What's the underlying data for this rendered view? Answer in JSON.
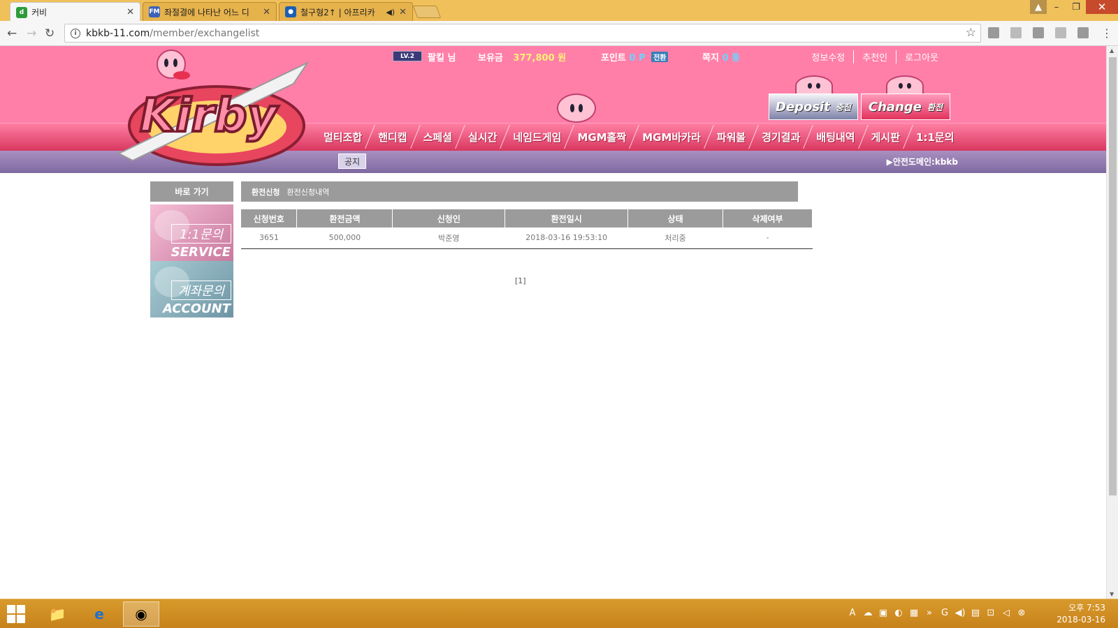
{
  "browser": {
    "tabs": [
      {
        "title": "커비",
        "favicon": "d",
        "active": true
      },
      {
        "title": "좌절결에 나타난 어느 디",
        "favicon": "FM",
        "active": false
      },
      {
        "title": "철구형2↑ | 아프리카",
        "favicon": "afreeca",
        "active": false
      }
    ],
    "url_host": "kbkb-11.com",
    "url_path": "/member/exchangelist"
  },
  "header": {
    "level_badge": "LV.2",
    "username": "팔킬 님",
    "balance_label": "보유금",
    "balance_value": "377,800 원",
    "points_label": "포인트",
    "points_value": "0 P",
    "convert_label": "전환",
    "messages_label": "쪽지",
    "messages_value": "0 통",
    "links": [
      "정보수정",
      "추천인",
      "로그아웃"
    ],
    "deposit_en": "Deposit",
    "deposit_ko": "충전",
    "change_en": "Change",
    "change_ko": "환전",
    "logo_text": "Kirby"
  },
  "nav": {
    "items": [
      "멀티조합",
      "핸디캡",
      "스페셜",
      "실시간",
      "네임드게임",
      "MGM홀짝",
      "MGM바카라",
      "파워볼",
      "경기결과",
      "배팅내역",
      "게시판",
      "1:1문의"
    ]
  },
  "notice": {
    "button": "공지",
    "safe_domain": "▶안전도메인:kbkb"
  },
  "sidebar": {
    "title": "바로 가기",
    "banners": [
      {
        "ko": "1:1문의",
        "en": "SERVICE"
      },
      {
        "ko": "계좌문의",
        "en": "ACCOUNT"
      }
    ]
  },
  "content": {
    "breadcrumb": [
      "환전신청",
      "환전신청내역"
    ],
    "columns": [
      "신청번호",
      "환전금액",
      "신청인",
      "환전일시",
      "상태",
      "삭제여부"
    ],
    "rows": [
      [
        "3651",
        "500,000",
        "박준영",
        "2018-03-16 19:53:10",
        "처리중",
        "-"
      ]
    ],
    "pager": "[1]"
  },
  "taskbar": {
    "clock_time": "오후 7:53",
    "clock_date": "2018-03-16"
  }
}
